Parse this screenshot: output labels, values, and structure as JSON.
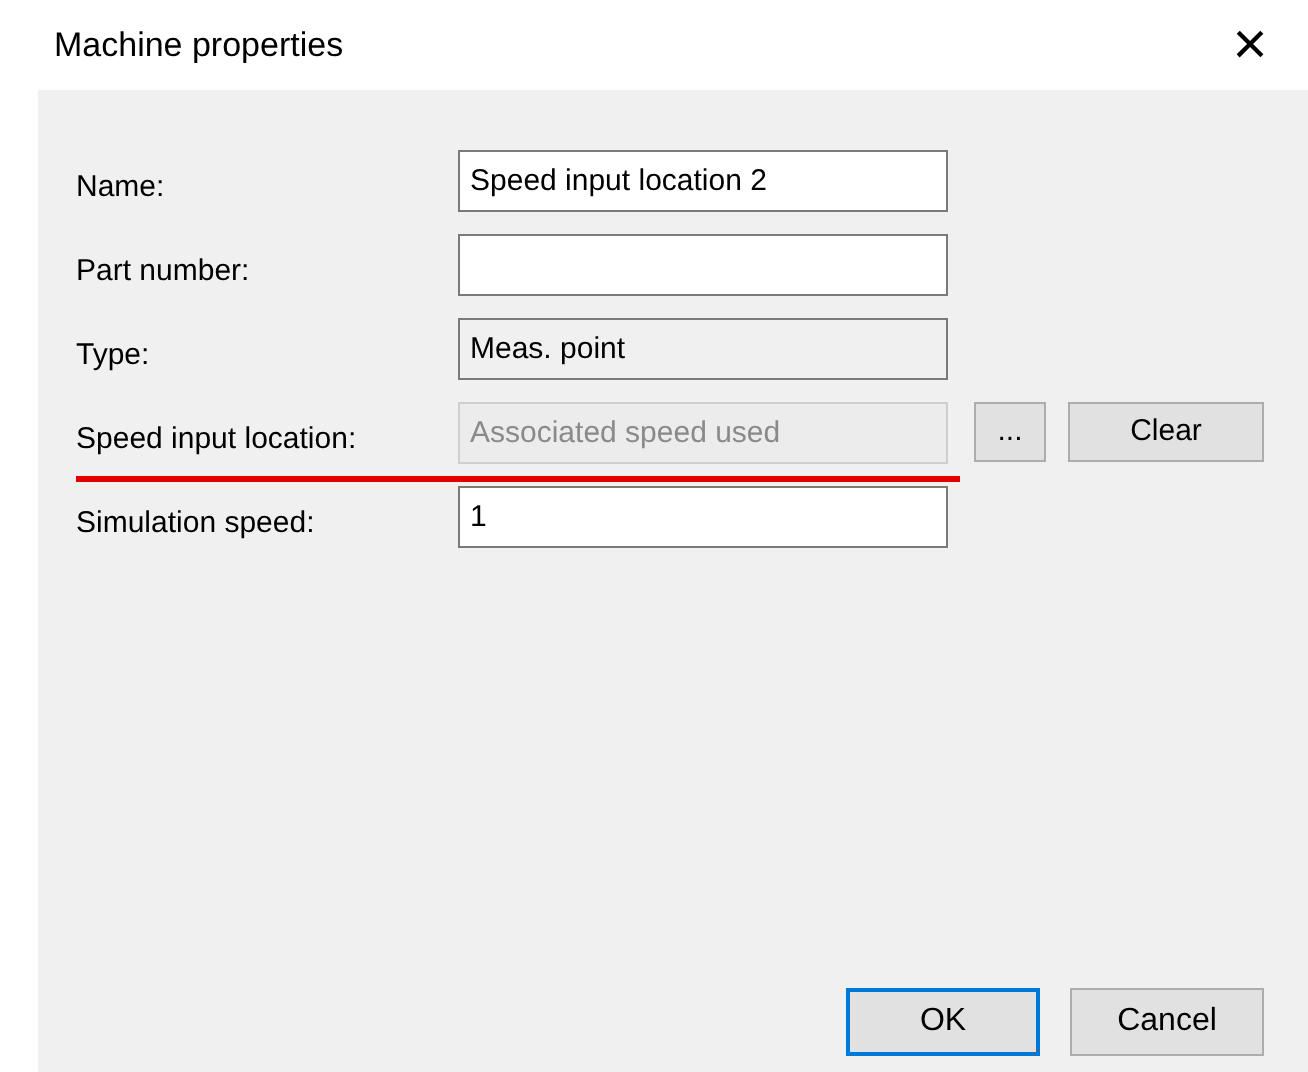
{
  "window": {
    "title": "Machine properties",
    "close": "×"
  },
  "fields": [
    {
      "label": "Name:",
      "kind": "text",
      "value": "Speed input location 2",
      "underlined": false
    },
    {
      "label": "Part number:",
      "kind": "text",
      "underlined": false
    },
    {
      "label": "Type:",
      "kind": "readonly",
      "value": "Meas. point",
      "underlined": false
    },
    {
      "label": "Speed input location:",
      "kind": "disabled",
      "value": "Associated speed used",
      "underlined": true,
      "buttons": [
        "...",
        "Clear"
      ]
    },
    {
      "label": "Simulation speed:",
      "kind": "text",
      "value": "1",
      "underlined": false
    }
  ],
  "buttons": [
    {
      "label": "OK",
      "default": true
    },
    {
      "label": "Cancel",
      "default": false
    }
  ]
}
